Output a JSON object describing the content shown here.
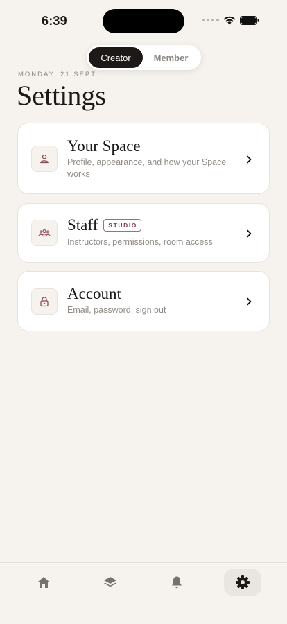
{
  "status_bar": {
    "time": "6:39"
  },
  "mode_switch": {
    "options": [
      "Creator",
      "Member"
    ],
    "selected": "Creator"
  },
  "header": {
    "date": "MONDAY, 21 SEPT",
    "title": "Settings"
  },
  "settings_items": [
    {
      "title": "Your Space",
      "description": "Profile, appearance, and how your Space works",
      "icon": "person-icon"
    },
    {
      "title": "Staff",
      "badge": "STUDIO",
      "description": "Instructors, permissions, room access",
      "icon": "people-icon"
    },
    {
      "title": "Account",
      "description": "Email, password, sign out",
      "icon": "lock-icon"
    }
  ],
  "tab_bar": {
    "tabs": [
      "home-icon",
      "layers-icon",
      "bell-icon",
      "gear-icon"
    ],
    "active": "gear-icon"
  },
  "colors": {
    "background": "#f6f3ee",
    "accent": "#7d3d4a",
    "dark": "#1c1917"
  }
}
